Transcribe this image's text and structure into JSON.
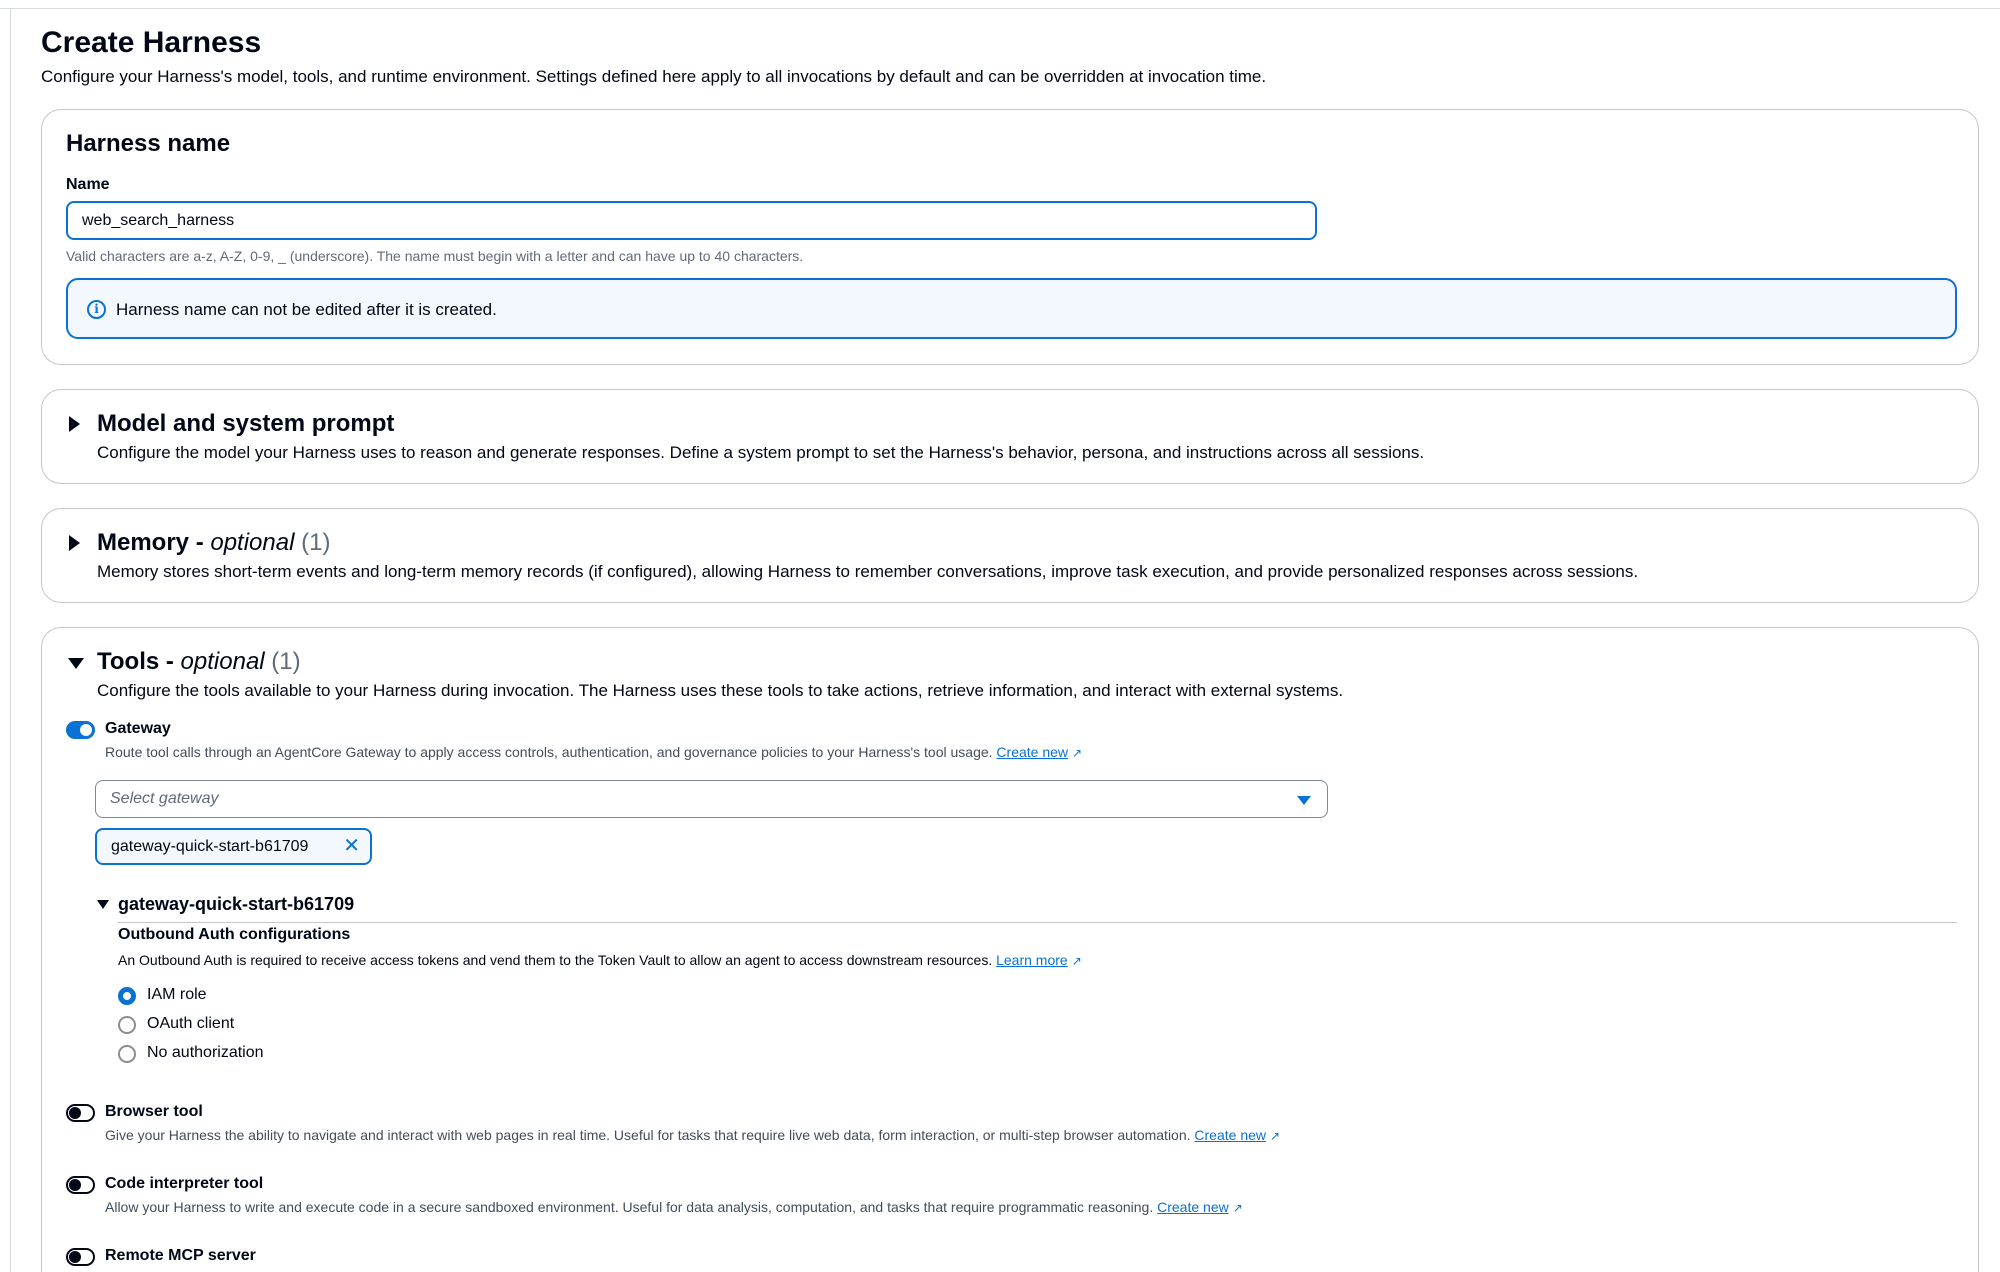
{
  "page": {
    "title": "Create Harness",
    "description": "Configure your Harness's model, tools, and runtime environment. Settings defined here apply to all invocations by default and can be overridden at invocation time."
  },
  "harness_name": {
    "section_title": "Harness name",
    "field_label": "Name",
    "value": "web_search_harness",
    "constraint": "Valid characters are a-z, A-Z, 0-9, _ (underscore). The name must begin with a letter and can have up to 40 characters.",
    "info": "Harness name can not be edited after it is created."
  },
  "model": {
    "title": "Model and system prompt",
    "description": "Configure the model your Harness uses to reason and generate responses. Define a system prompt to set the Harness's behavior, persona, and instructions across all sessions."
  },
  "memory": {
    "title": "Memory",
    "separator": " - ",
    "optional": "optional",
    "count": " (1)",
    "description": "Memory stores short-term events and long-term memory records (if configured), allowing Harness to remember conversations, improve task execution, and provide personalized responses across sessions."
  },
  "tools": {
    "title": "Tools",
    "separator": " - ",
    "optional": "optional",
    "count": " (1)",
    "description": "Configure the tools available to your Harness during invocation. The Harness uses these tools to take actions, retrieve information, and interact with external systems.",
    "gateway": {
      "label": "Gateway",
      "enabled": true,
      "description": "Route tool calls through an AgentCore Gateway to apply access controls, authentication, and governance policies to your Harness's tool usage.",
      "link": "Create new",
      "select_placeholder": "Select gateway",
      "selected_token": "gateway-quick-start-b61709",
      "expanded_name": "gateway-quick-start-b61709",
      "outbound_title": "Outbound Auth configurations",
      "outbound_desc": "An Outbound Auth is required to receive access tokens and vend them to the Token Vault to allow an agent to access downstream resources.",
      "outbound_link": "Learn more",
      "auth_options": [
        "IAM role",
        "OAuth client",
        "No authorization"
      ],
      "auth_selected": "IAM role"
    },
    "browser": {
      "label": "Browser tool",
      "enabled": false,
      "description": "Give your Harness the ability to navigate and interact with web pages in real time. Useful for tasks that require live web data, form interaction, or multi-step browser automation.",
      "link": "Create new"
    },
    "code": {
      "label": "Code interpreter tool",
      "enabled": false,
      "description": "Allow your Harness to write and execute code in a secure sandboxed environment. Useful for data analysis, computation, and tasks that require programmatic reasoning.",
      "link": "Create new"
    },
    "mcp": {
      "label": "Remote MCP server",
      "enabled": false
    }
  },
  "colors": {
    "accent": "#0972d3",
    "text": "#000716",
    "border": "#c6c6cd"
  }
}
